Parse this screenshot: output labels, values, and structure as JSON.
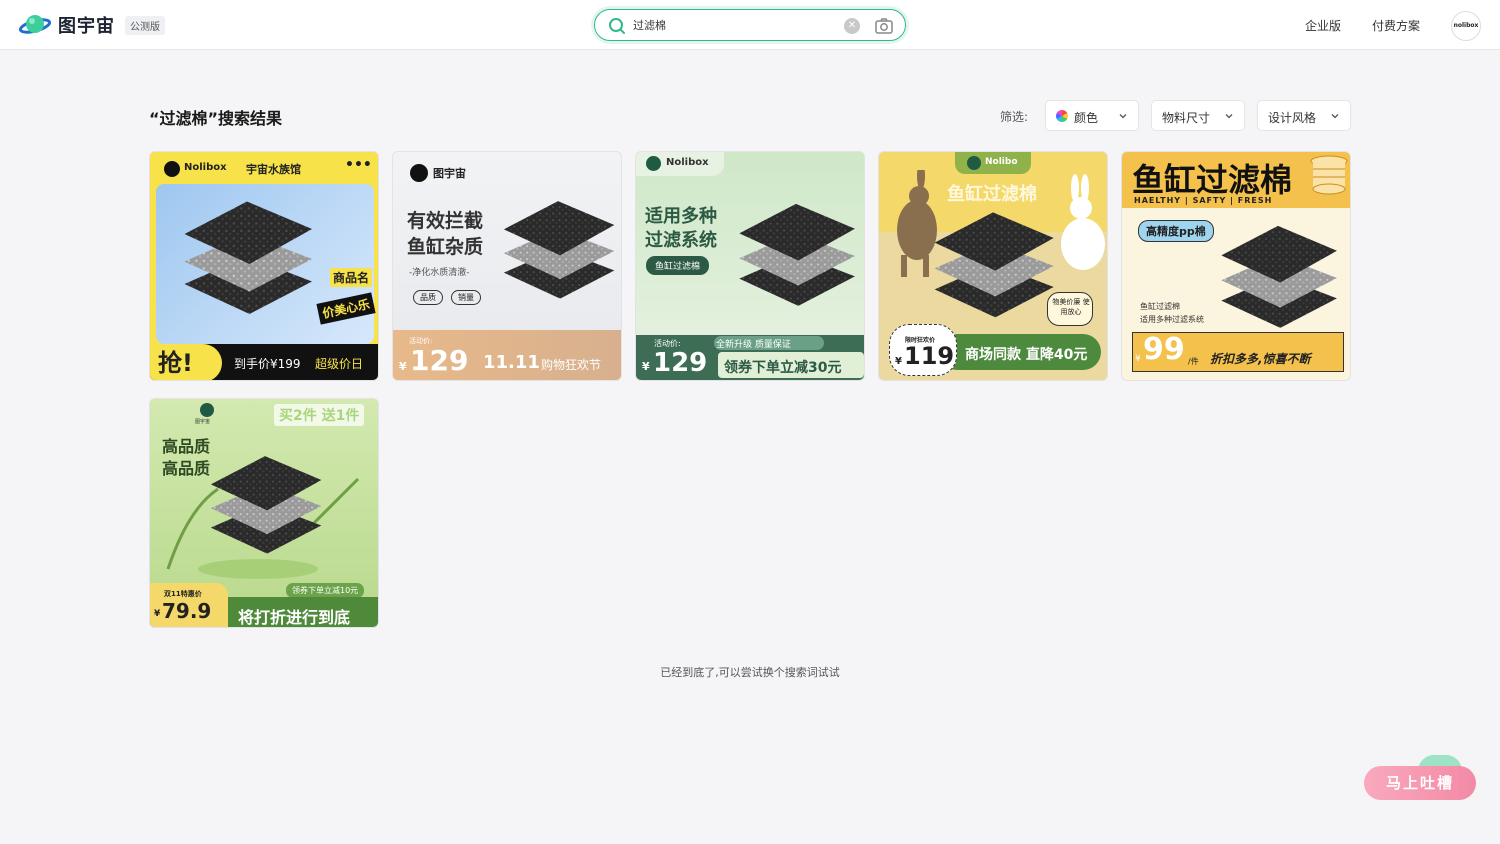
{
  "header": {
    "logo_text": "图宇宙",
    "beta_badge": "公测版",
    "search_value": "过滤棉",
    "links": [
      "企业版",
      "付费方案"
    ],
    "avatar_text": "nolibox"
  },
  "toolbar": {
    "title": "“过滤棉”搜索结果",
    "filter_label": "筛选:",
    "filters": [
      "颜色",
      "物料尺寸",
      "设计风格"
    ]
  },
  "cards": [
    {
      "brand": "Nolibox",
      "shop": "宇宙水族馆",
      "product_tag": "商品名",
      "slogan": "价美心乐",
      "grab": "抢!",
      "price_line": "到手价¥199",
      "super_day": "超级价日"
    },
    {
      "brand": "图宇宙",
      "headline1": "有效拦截",
      "headline2": "鱼缸杂质",
      "sub": "-净化水质清澈-",
      "tags": [
        "品质",
        "销量"
      ],
      "promo_label": "活动价:",
      "currency": "¥",
      "price": "129",
      "event_num": "11.11",
      "event_text": "购物狂欢节"
    },
    {
      "brand": "Nolibox",
      "headline1": "适用多种",
      "headline2": "过滤系统",
      "pill": "鱼缸过滤棉",
      "promo_label": "活动价:",
      "banner": "全新升级 质量保证",
      "currency": "¥",
      "price": "129",
      "coupon": "领券下单立减30元"
    },
    {
      "brand": "Nolibo",
      "headline": "鱼缸过滤棉",
      "badge": "物美价廉 使用放心",
      "promo_label": "限时狂欢价",
      "currency": "¥",
      "price": "119",
      "strip": "商场同款 直降40元"
    },
    {
      "headline": "鱼缸过滤棉",
      "subline": "HAELTHY | SAFTY | FRESH",
      "pill": "高精度pp棉",
      "desc1": "鱼缸过滤棉",
      "desc2": "适用多种过滤系统",
      "currency": "¥",
      "price": "99",
      "unit": "/件",
      "strip": "折扣多多,惊喜不断"
    },
    {
      "brand": "图宇宙",
      "offer": "买2件 送1件",
      "headline1": "高品质",
      "headline2": "高品质",
      "coupon": "领券下单立减10元",
      "promo_label": "双11特惠价",
      "currency": "¥",
      "price": "79.9",
      "strip": "将打折进行到底"
    }
  ],
  "footer": {
    "end_text": "已经到底了,可以尝试换个搜索词试试",
    "feedback": "马上吐槽"
  }
}
